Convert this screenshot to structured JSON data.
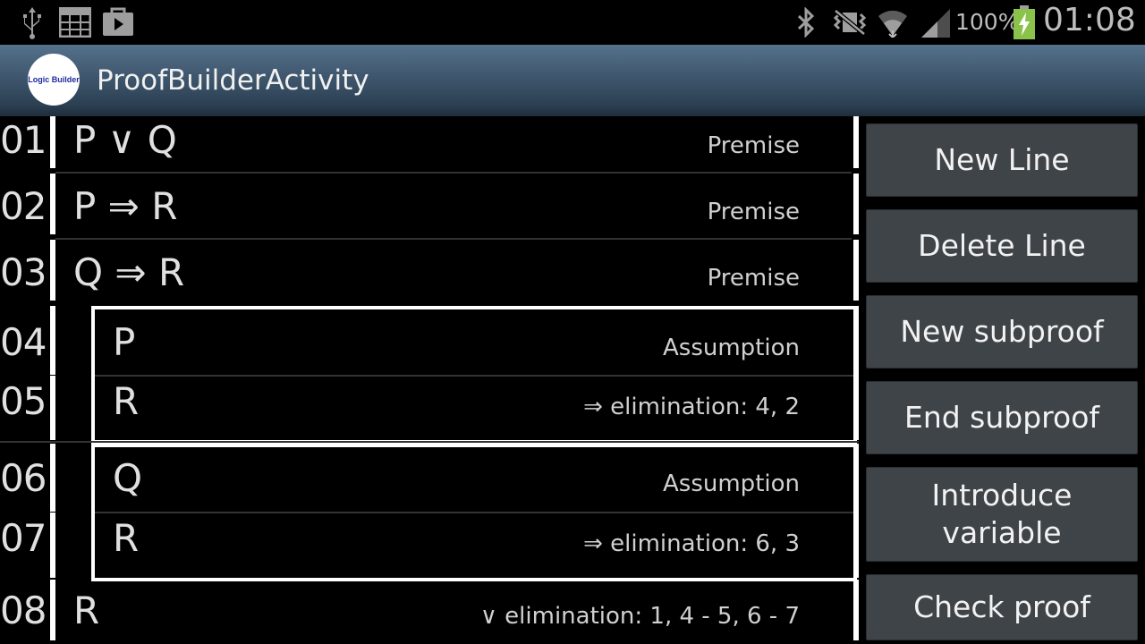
{
  "status_bar": {
    "battery": "100%",
    "time": "01:08",
    "icons": [
      "usb-icon",
      "calendar-grid-icon",
      "play-store-icon",
      "bluetooth-icon",
      "vibrate-muted-icon",
      "wifi-icon",
      "signal-icon",
      "battery-charging-icon"
    ]
  },
  "action_bar": {
    "logo_text": "Logic Builder",
    "title": "ProofBuilderActivity"
  },
  "proof": {
    "lines": [
      {
        "num": "01",
        "formula": "P ∨ Q",
        "justification": "Premise"
      },
      {
        "num": "02",
        "formula": "P ⇒ R",
        "justification": "Premise"
      },
      {
        "num": "03",
        "formula": "Q ⇒ R",
        "justification": "Premise"
      },
      {
        "num": "04",
        "formula": "P",
        "justification": "Assumption"
      },
      {
        "num": "05",
        "formula": "R",
        "justification": "⇒ elimination: 4, 2"
      },
      {
        "num": "06",
        "formula": "Q",
        "justification": "Assumption"
      },
      {
        "num": "07",
        "formula": "R",
        "justification": "⇒ elimination: 6, 3"
      },
      {
        "num": "08",
        "formula": "R",
        "justification": "∨ elimination: 1, 4 - 5, 6 - 7"
      }
    ]
  },
  "buttons": {
    "new_line": "New Line",
    "delete_line": "Delete Line",
    "new_subproof": "New subproof",
    "end_subproof": "End subproof",
    "introduce_variable_1": "Introduce",
    "introduce_variable_2": "variable",
    "check_proof": "Check proof"
  },
  "colors": {
    "action_bar_top": "#55718c",
    "action_bar_bottom": "#1e2d3a",
    "button_bg": "#3f4449",
    "battery_green": "#8bc34a"
  }
}
